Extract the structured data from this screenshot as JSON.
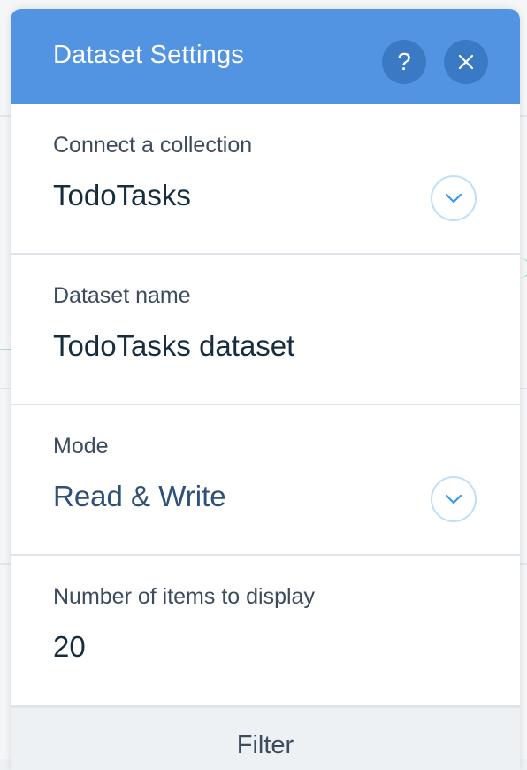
{
  "panel": {
    "title": "Dataset Settings",
    "help_label": "?"
  },
  "sections": {
    "collection": {
      "label": "Connect a collection",
      "value": "TodoTasks"
    },
    "dataset_name": {
      "label": "Dataset name",
      "value": "TodoTasks dataset"
    },
    "mode": {
      "label": "Mode",
      "value": "Read & Write"
    },
    "items": {
      "label": "Number of items to display",
      "value": "20"
    }
  },
  "filter": {
    "label": "Filter"
  },
  "icons": {
    "help": "help-icon",
    "close": "close-icon",
    "dropdown": "chevron-down-icon"
  },
  "colors": {
    "header": "#5294e2",
    "header_button": "#3a79c4",
    "text_dark": "#162d3d",
    "text_label": "#3c4c5e",
    "dropdown_ring": "#bde0f6",
    "chevron": "#3899ec"
  }
}
